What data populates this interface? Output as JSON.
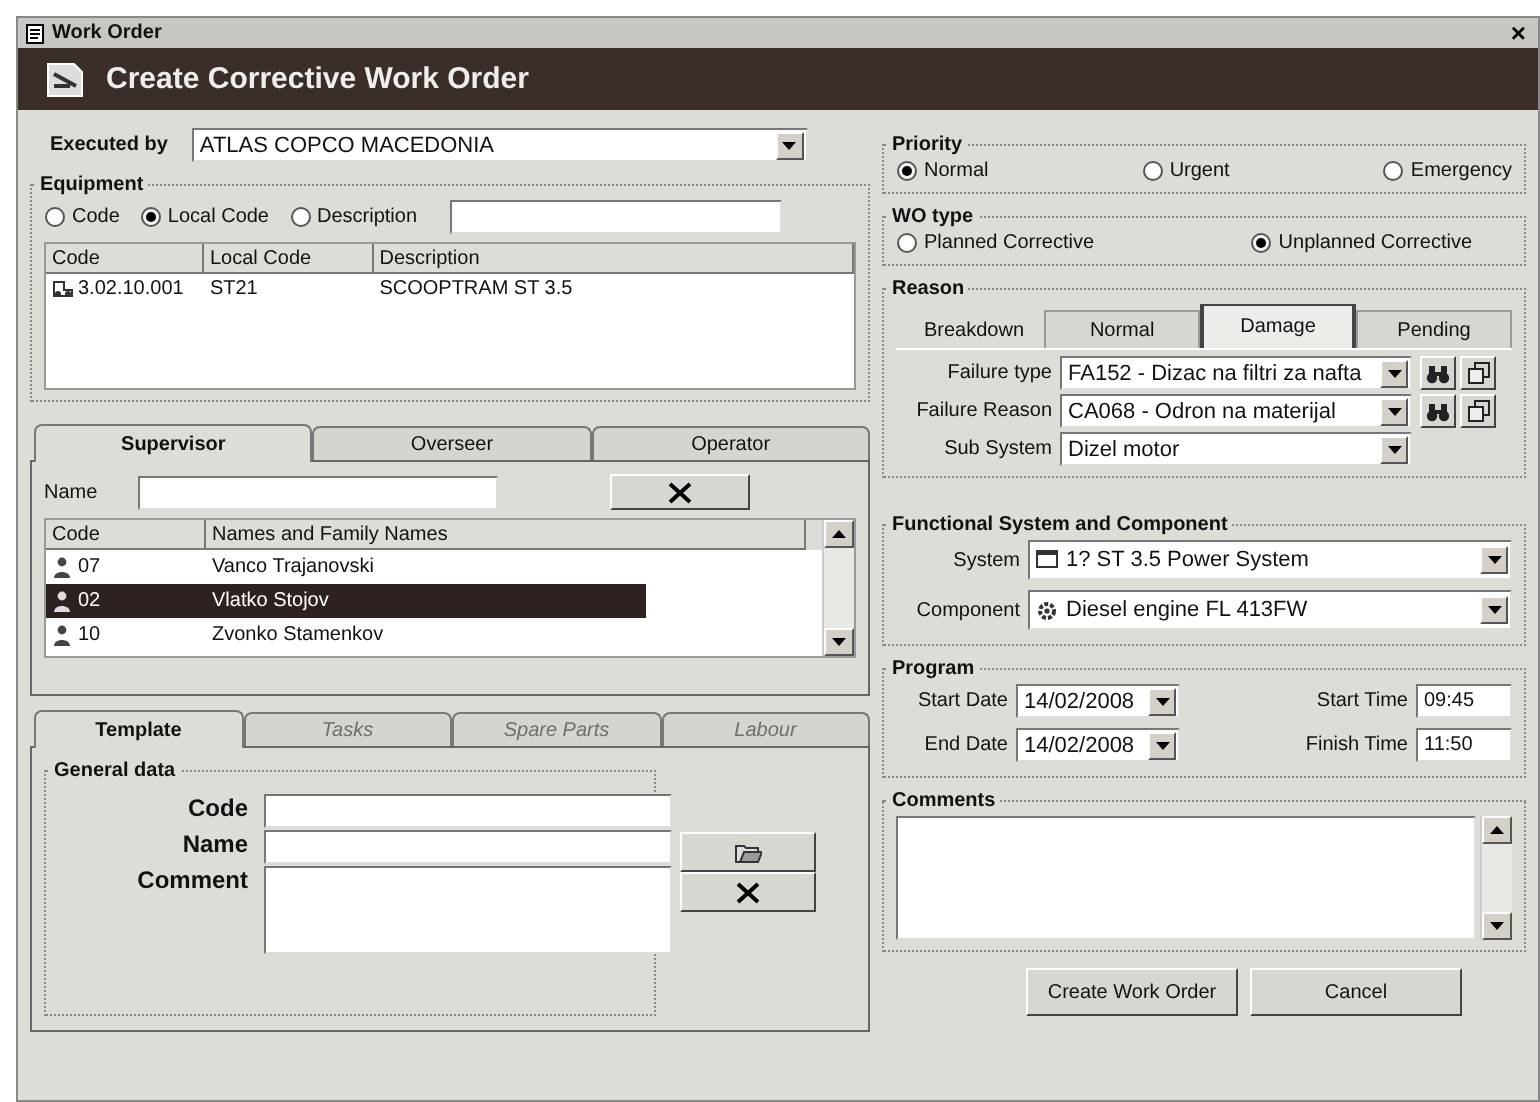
{
  "window": {
    "title": "Work Order",
    "close": "×"
  },
  "banner": {
    "title": "Create Corrective Work Order"
  },
  "executed_by": {
    "label": "Executed by",
    "value": "ATLAS COPCO MACEDONIA"
  },
  "equipment": {
    "title": "Equipment",
    "search_by": [
      {
        "label": "Code",
        "selected": false
      },
      {
        "label": "Local Code",
        "selected": true
      },
      {
        "label": "Description",
        "selected": false
      }
    ],
    "table": {
      "columns": [
        "Code",
        "Local Code",
        "Description"
      ],
      "rows": [
        {
          "cells": [
            "3.02.10.001",
            "ST21",
            "SCOOPTRAM  ST 3.5"
          ]
        }
      ]
    }
  },
  "people_tabs": [
    {
      "label": "Supervisor",
      "selected": true,
      "disabled": false
    },
    {
      "label": "Overseer",
      "selected": false,
      "disabled": false
    },
    {
      "label": "Operator",
      "selected": false,
      "disabled": false
    }
  ],
  "people": {
    "name_label": "Name",
    "columns": [
      "Code",
      "Names and Family Names"
    ],
    "rows": [
      {
        "code": "07",
        "name": "Vanco  Trajanovski",
        "selected": false
      },
      {
        "code": "02",
        "name": "Vlatko  Stojov",
        "selected": true
      },
      {
        "code": "10",
        "name": "Zvonko  Stamenkov",
        "selected": false
      }
    ]
  },
  "template_tabs": [
    {
      "label": "Template",
      "selected": true,
      "disabled": false
    },
    {
      "label": "Tasks",
      "selected": false,
      "disabled": true
    },
    {
      "label": "Spare Parts",
      "selected": false,
      "disabled": true
    },
    {
      "label": "Labour",
      "selected": false,
      "disabled": true
    }
  ],
  "general_data": {
    "title": "General data",
    "fields": [
      {
        "label": "Code",
        "kind": "line"
      },
      {
        "label": "Name",
        "kind": "line"
      },
      {
        "label": "Comment",
        "kind": "area"
      }
    ]
  },
  "priority": {
    "title": "Priority",
    "options": [
      {
        "label": "Normal",
        "selected": true
      },
      {
        "label": "Urgent",
        "selected": false
      },
      {
        "label": "Emergency",
        "selected": false
      }
    ]
  },
  "wo_type": {
    "title": "WO type",
    "options": [
      {
        "label": "Planned Corrective",
        "selected": false
      },
      {
        "label": "Unplanned Corrective",
        "selected": true
      }
    ]
  },
  "reason": {
    "title": "Reason",
    "breakdown_label": "Breakdown",
    "tabs": [
      {
        "label": "Normal",
        "selected": false
      },
      {
        "label": "Damage",
        "selected": true
      },
      {
        "label": "Pending",
        "selected": false
      }
    ],
    "fields": [
      {
        "label": "Failure type",
        "value": "FA152 - Dizac na filtri za nafta",
        "kind": "lookup"
      },
      {
        "label": "Failure Reason",
        "value": "CA068 - Odron na materijal",
        "kind": "lookup"
      },
      {
        "label": "Sub System",
        "value": "Dizel motor",
        "kind": "plain"
      }
    ]
  },
  "functional": {
    "title": "Functional System and Component",
    "fields": [
      {
        "label": "System",
        "value": "1? ST 3.5 Power System",
        "kind": "system"
      },
      {
        "label": "Component",
        "value": "Diesel engine FL 413FW",
        "kind": "component"
      }
    ]
  },
  "program": {
    "title": "Program",
    "start_date_label": "Start Date",
    "start_date": "14/02/2008",
    "end_date_label": "End Date",
    "end_date": "14/02/2008",
    "start_time_label": "Start Time",
    "start_time": "09:45",
    "finish_time_label": "Finish Time",
    "finish_time": "11:50"
  },
  "comments": {
    "title": "Comments"
  },
  "buttons": [
    "Create Work Order",
    "Cancel"
  ]
}
